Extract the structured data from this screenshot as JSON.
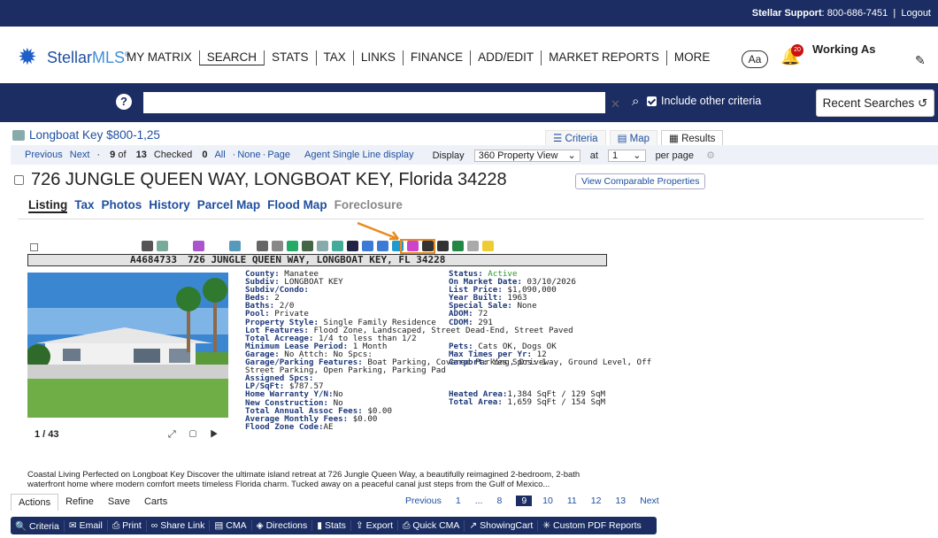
{
  "top": {
    "support_label": "Stellar Support",
    "support_phone": ": 800-686-7451",
    "logout": "Logout"
  },
  "logo": {
    "text1": "Stellar",
    "text2": "MLS",
    "tm": "®"
  },
  "nav": [
    "MY MATRIX",
    "SEARCH",
    "STATS",
    "TAX",
    "LINKS",
    "FINANCE",
    "ADD/EDIT",
    "MARKET REPORTS",
    "MORE"
  ],
  "header": {
    "aa": "Aa",
    "badge": "20",
    "working_as": "Working As"
  },
  "search": {
    "placeholder": "",
    "include_label": "Include other criteria",
    "recent": "Recent Searches"
  },
  "crumb": "Longboat Key $800-1,25",
  "views": [
    "Criteria",
    "Map",
    "Results"
  ],
  "pager": {
    "previous": "Previous",
    "next": "Next",
    "pos_prefix": "· ",
    "pos": "9",
    "of": " of ",
    "total": "13",
    "checked_label": "Checked",
    "checked": "0",
    "all": "All",
    "none": "None",
    "page": "Page",
    "sep": "·",
    "display_label": "Agent Single Line display",
    "display": "Display",
    "view": "360 Property View",
    "at": "at",
    "at_val": "1",
    "per_page": "per page"
  },
  "listing": {
    "address": "726 JUNGLE QUEEN WAY, LONGBOAT KEY, Florida 34228",
    "compare_btn": "View Comparable Properties",
    "tabs": [
      "Listing",
      "Tax",
      "Photos",
      "History",
      "Parcel Map",
      "Flood Map",
      "Foreclosure"
    ],
    "mls": "A4684733",
    "addr_line": "726 JUNGLE QUEEN WAY, LONGBOAT KEY, FL 34228",
    "photo_count": "1 / 43",
    "left": [
      [
        "County:",
        "Manatee"
      ],
      [
        "Subdiv:",
        "LONGBOAT KEY"
      ],
      [
        "Subdiv/Condo:",
        ""
      ],
      [
        "Beds:",
        "2"
      ],
      [
        "Baths:",
        "2/0"
      ],
      [
        "Pool:",
        "Private"
      ],
      [
        "Property Style:",
        "Single Family Residence"
      ],
      [
        "Lot Features:",
        "Flood Zone, Landscaped, Street Dead-End, Street Paved"
      ],
      [
        "Total Acreage:",
        "1/4 to less than 1/2"
      ],
      [
        "Minimum Lease Period:",
        "1 Month"
      ],
      [
        "Garage:",
        "No  Attch: No  Spcs:"
      ],
      [
        "Garage/Parking Features:",
        "Boat Parking, Covered Parking, Driveway, Ground Level, Off"
      ],
      [
        "",
        "Street Parking, Open Parking, Parking Pad"
      ],
      [
        "Assigned Spcs:",
        ""
      ],
      [
        "LP/SqFt:",
        "$787.57"
      ],
      [
        "Home Warranty Y/N:",
        "No"
      ],
      [
        "New Construction:",
        "No"
      ],
      [
        "Total Annual Assoc Fees:",
        "$0.00"
      ],
      [
        "Average Monthly Fees:",
        "$0.00"
      ],
      [
        "Flood Zone Code:",
        "AE"
      ]
    ],
    "right": [
      [
        "Status:",
        "Active"
      ],
      [
        "On Market Date:",
        "03/10/2026"
      ],
      [
        "List Price:",
        "$1,090,000"
      ],
      [
        "Year Built:",
        "1963"
      ],
      [
        "Special Sale:",
        "None"
      ],
      [
        "ADOM:",
        "72"
      ],
      [
        "CDOM:",
        "291"
      ],
      [
        "Pets:",
        "Cats OK, Dogs OK"
      ],
      [
        "Max Times per Yr:",
        "12"
      ],
      [
        "Carport:",
        "Yes  Spcs: 1"
      ],
      [
        "Heated Area:",
        "1,384 SqFt / 129 SqM"
      ],
      [
        "Total Area:",
        "1,659 SqFt / 154 SqM"
      ]
    ],
    "description": "Coastal Living Perfected on Longboat Key Discover the ultimate island retreat at 726 Jungle Queen Way, a beautifully reimagined 2-bedroom, 2-bath waterfront home where modern comfort meets timeless Florida charm. Tucked away on a peaceful canal just steps from the Gulf of Mexico..."
  },
  "bottom": {
    "tabs": [
      "Actions",
      "Refine",
      "Save",
      "Carts"
    ],
    "pages": [
      "Previous",
      "1",
      "...",
      "8",
      "9",
      "10",
      "11",
      "12",
      "13",
      "Next"
    ]
  },
  "actions": [
    "Criteria",
    "Email",
    "Print",
    "Share Link",
    "CMA",
    "Directions",
    "Stats",
    "Export",
    "Quick CMA",
    "ShowingCart",
    "Custom PDF Reports"
  ],
  "colors": {
    "navy": "#1b2d63",
    "link": "#1f4fa0",
    "highlight": "#e98a1f",
    "active_status": "#2a9a2a"
  }
}
